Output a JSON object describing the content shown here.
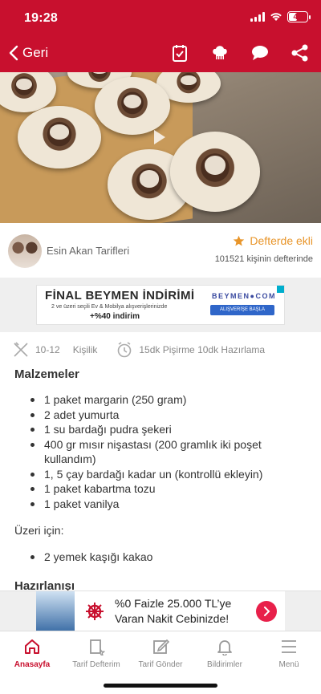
{
  "status_bar": {
    "time": "19:28",
    "battery": "41"
  },
  "header": {
    "back_label": "Geri",
    "icons": [
      "notebook-icon",
      "chef-hat-icon",
      "chat-icon",
      "share-icon"
    ],
    "color": "#c8102e"
  },
  "author": {
    "name": "Esin Akan Tarifleri",
    "favorite_label": "Defterde ekli",
    "favorite_count": "101521 kişinin defterinde"
  },
  "ad_top": {
    "title": "FİNAL BEYMEN İNDİRİMİ",
    "subtitle": "2 ve üzeri seçili Ev & Mobilya alışverişlerinizde",
    "discount": "+%40 indirim",
    "brand": "BEYMEN●COM",
    "button": "ALIŞVERİŞE BAŞLA"
  },
  "meta": {
    "servings": "10-12",
    "servings_unit": "Kişilik",
    "time": "15dk Pişirme 10dk Hazırlama"
  },
  "recipe": {
    "ingredients_title": "Malzemeler",
    "ingredients": [
      "1 paket margarin (250 gram)",
      "2 adet yumurta",
      "1 su bardağı pudra şekeri",
      "400 gr mısır nişastası (200 gramlık iki poşet kullandım)",
      "1, 5 çay bardağı kadar un (kontrollü ekleyin)",
      "1 paket kabartma tozu",
      "1 paket vanilya"
    ],
    "topping_title": "Üzeri için:",
    "topping": [
      "2 yemek kaşığı kakao"
    ],
    "preparation_title": "Hazırlanışı"
  },
  "ad_bottom": {
    "line1": "%0 Faizle 25.000 TL’ye",
    "line2": "Varan Nakit Cebinizde!"
  },
  "tabs": [
    {
      "label": "Anasayfa",
      "icon": "home-icon",
      "active": true
    },
    {
      "label": "Tarif Defterim",
      "icon": "recipe-book-icon",
      "active": false
    },
    {
      "label": "Tarif Gönder",
      "icon": "edit-icon",
      "active": false
    },
    {
      "label": "Bildirimler",
      "icon": "bell-icon",
      "active": false
    },
    {
      "label": "Menü",
      "icon": "menu-icon",
      "active": false
    }
  ]
}
